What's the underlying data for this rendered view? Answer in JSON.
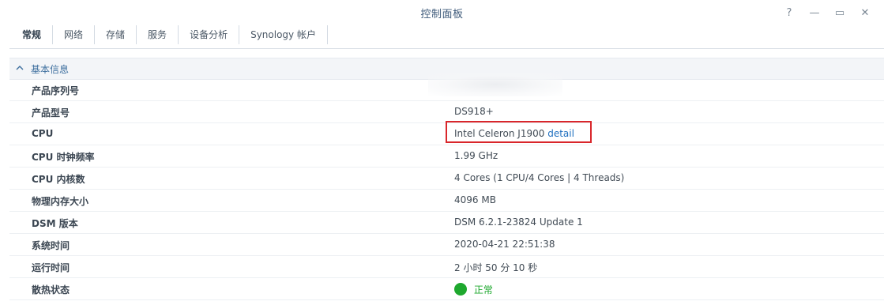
{
  "window": {
    "title": "控制面板",
    "controls": [
      "help-icon",
      "minimize-icon",
      "maximize-icon",
      "close-icon"
    ],
    "help_glyph": "?",
    "minimize_glyph": "—",
    "maximize_glyph": "▭",
    "close_glyph": "✕"
  },
  "tabs": [
    {
      "label": "常规",
      "active": true
    },
    {
      "label": "网络"
    },
    {
      "label": "存储"
    },
    {
      "label": "服务"
    },
    {
      "label": "设备分析"
    },
    {
      "label": "Synology 帐户"
    }
  ],
  "section": {
    "title": "基本信息",
    "icon": "chevron-up-icon"
  },
  "info": {
    "serial": {
      "label": "产品序列号",
      "value": ""
    },
    "model": {
      "label": "产品型号",
      "value": "DS918+"
    },
    "cpu": {
      "label": "CPU",
      "value": "Intel Celeron J1900",
      "link": "detail"
    },
    "clock": {
      "label": "CPU 时钟频率",
      "value": "1.99 GHz"
    },
    "cores": {
      "label": "CPU 内核数",
      "value": "4 Cores (1 CPU/4 Cores | 4 Threads)"
    },
    "memory": {
      "label": "物理内存大小",
      "value": "4096 MB"
    },
    "dsm": {
      "label": "DSM 版本",
      "value": "DSM 6.2.1-23824 Update 1"
    },
    "time": {
      "label": "系统时间",
      "value": "2020-04-21 22:51:38"
    },
    "uptime": {
      "label": "运行时间",
      "value": "2 小时 50 分 10 秒"
    },
    "thermal": {
      "label": "散热状态",
      "value": "正常",
      "color": "#1ea82e"
    }
  },
  "colors": {
    "highlight_border": "#d9262b",
    "link": "#1f6fbf",
    "section_title": "#3c6e9e"
  }
}
